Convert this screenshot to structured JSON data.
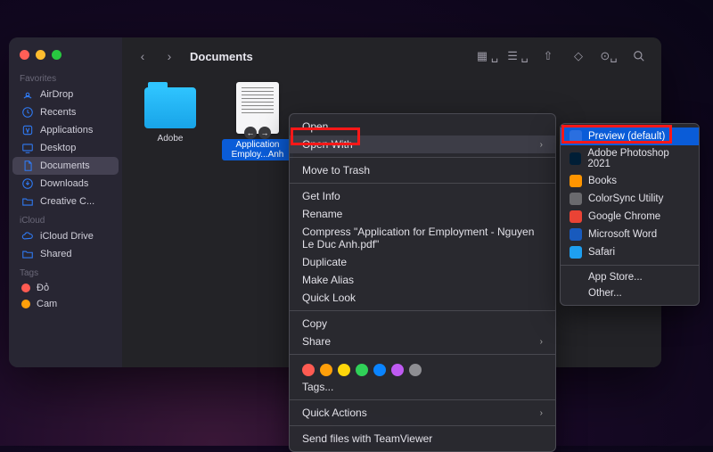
{
  "window": {
    "title": "Documents"
  },
  "sidebar": {
    "sections": [
      {
        "label": "Favorites",
        "items": [
          {
            "icon": "airdrop-icon",
            "label": "AirDrop"
          },
          {
            "icon": "recents-icon",
            "label": "Recents"
          },
          {
            "icon": "applications-icon",
            "label": "Applications"
          },
          {
            "icon": "desktop-icon",
            "label": "Desktop"
          },
          {
            "icon": "documents-icon",
            "label": "Documents",
            "active": true
          },
          {
            "icon": "downloads-icon",
            "label": "Downloads"
          },
          {
            "icon": "folder-icon",
            "label": "Creative C..."
          }
        ]
      },
      {
        "label": "iCloud",
        "items": [
          {
            "icon": "icloud-icon",
            "label": "iCloud Drive"
          },
          {
            "icon": "shared-icon",
            "label": "Shared"
          }
        ]
      },
      {
        "label": "Tags",
        "items": [
          {
            "icon": "tag-dot",
            "label": "Đỏ",
            "color": "#ff5b52"
          },
          {
            "icon": "tag-dot",
            "label": "Cam",
            "color": "#ff9f0a"
          }
        ]
      }
    ]
  },
  "files": [
    {
      "name": "Adobe",
      "type": "folder"
    },
    {
      "name": "Application Employ...Anh",
      "type": "document",
      "selected": true
    }
  ],
  "context_menu": {
    "groups": [
      [
        "Open",
        {
          "label": "Open With",
          "submenu": true,
          "hover": true
        }
      ],
      [
        "Move to Trash"
      ],
      [
        "Get Info",
        "Rename",
        "Compress \"Application for Employment - Nguyen Le Duc Anh.pdf\"",
        "Duplicate",
        "Make Alias",
        "Quick Look"
      ],
      [
        "Copy",
        {
          "label": "Share",
          "submenu": true
        }
      ],
      [
        {
          "type": "tag-row",
          "colors": [
            "#ff5b52",
            "#ff9f0a",
            "#ffd60a",
            "#30d158",
            "#0a84ff",
            "#bf5af2",
            "#8e8e93"
          ]
        },
        "Tags..."
      ],
      [
        {
          "label": "Quick Actions",
          "submenu": true
        }
      ],
      [
        "Send files with TeamViewer"
      ]
    ]
  },
  "submenu": {
    "items": [
      {
        "label": "Preview (default)",
        "icon_bg": "#2a6fe0",
        "selected": true
      },
      {
        "label": "Adobe Photoshop 2021",
        "icon_bg": "#001e36"
      },
      {
        "label": "Books",
        "icon_bg": "#ff9500"
      },
      {
        "label": "ColorSync Utility",
        "icon_bg": "#6a6a6e"
      },
      {
        "label": "Google Chrome",
        "icon_bg": "#ea4335"
      },
      {
        "label": "Microsoft Word",
        "icon_bg": "#185abd"
      },
      {
        "label": "Safari",
        "icon_bg": "#1e9ff0"
      }
    ],
    "footer": [
      "App Store...",
      "Other..."
    ]
  }
}
